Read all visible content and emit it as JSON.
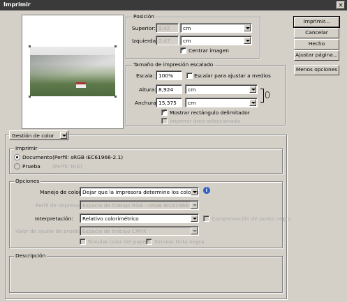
{
  "window": {
    "title": "Imprimir",
    "close_glyph": "×"
  },
  "buttons": {
    "print": "Imprimir...",
    "cancel": "Cancelar",
    "done": "Hecho",
    "page_setup": "Ajustar página...",
    "fewer_options": "Menos opciones"
  },
  "position": {
    "title": "Posición",
    "top_label": "Superior:",
    "top_value": "9,42",
    "top_unit": "cm",
    "left_label": "Izquierda:",
    "left_value": "2,47",
    "left_unit": "cm",
    "center_label": "Centrar imagen",
    "center_checked": true
  },
  "scaled": {
    "title": "Tamaño de impresión escalado",
    "scale_label": "Escala:",
    "scale_value": "100%",
    "fit_label": "Escalar para ajustar a medios",
    "fit_checked": false,
    "height_label": "Altura:",
    "height_value": "8,924",
    "height_unit": "cm",
    "width_label": "Anchura:",
    "width_value": "15,375",
    "width_unit": "cm",
    "bbox_label": "Mostrar rectángulo delimitador",
    "bbox_checked": true,
    "print_sel_label": "Imprimir área seleccionada",
    "print_sel_checked": false
  },
  "color_mgmt": {
    "dropdown": "Gestión de color",
    "print_group": "Imprimir",
    "doc_label": "Documento",
    "doc_profile": "(Perfil: sRGB IEC61966-2.1)",
    "proof_label": "Prueba",
    "proof_profile": "(Perfil: N/D)",
    "options_group": "Opciones",
    "color_handling_label": "Manejo de color:",
    "color_handling_value": "Dejar que la impresora determine los colores",
    "printer_profile_label": "Perfil de impresora:",
    "printer_profile_value": "Espacio de trabajo RGB - sRGB IEC61966-2.1",
    "intent_label": "Interpretación:",
    "intent_value": "Relativo colorimétrico",
    "bpc_label": "Compensación de punto negro",
    "proof_setup_label": "Valor de ajuste de prueba:",
    "proof_setup_value": "Espacio de trabajo CMYK",
    "sim_paper_label": "Simular color del papel",
    "sim_ink_label": "Simular tinta negra",
    "info_glyph": "i",
    "description_group": "Descripción"
  }
}
